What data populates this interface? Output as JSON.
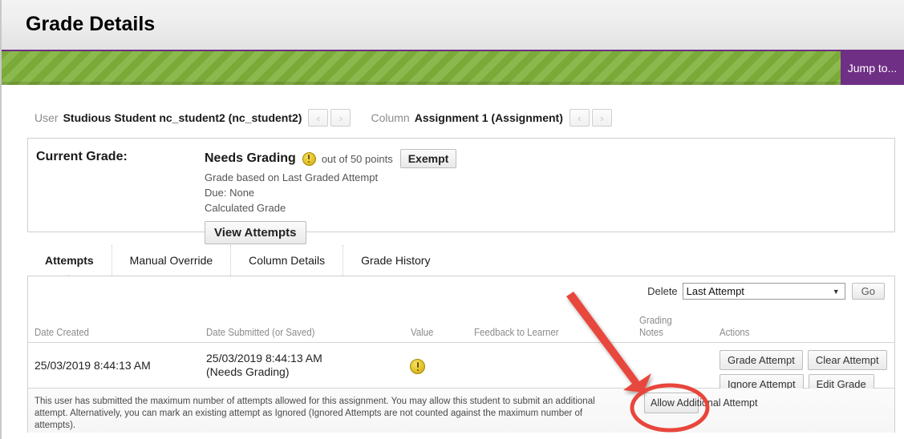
{
  "header": {
    "title": "Grade Details"
  },
  "banner": {
    "jump_to_label": "Jump to...",
    "accent_purple": "#6f2f84",
    "band_green": "#7fb13a"
  },
  "navigation": {
    "user_label": "User",
    "user_value": "Studious Student nc_student2 (nc_student2)",
    "user_prev": "‹",
    "user_next": "›",
    "column_label": "Column",
    "column_value": "Assignment 1 (Assignment)",
    "column_prev": "‹",
    "column_next": "›"
  },
  "current_grade": {
    "label": "Current Grade:",
    "grade_status": "Needs Grading",
    "status_icon": "warning-exclamation-icon",
    "out_of": "out of 50 points",
    "exempt_label": "Exempt",
    "based_on": "Grade based on Last Graded Attempt",
    "due": "Due: None",
    "calculated": "Calculated Grade",
    "view_attempts_label": "View Attempts"
  },
  "tabs": [
    {
      "label": "Attempts",
      "active": true
    },
    {
      "label": "Manual Override",
      "active": false
    },
    {
      "label": "Column Details",
      "active": false
    },
    {
      "label": "Grade History",
      "active": false
    }
  ],
  "delete_bar": {
    "label": "Delete",
    "selected_option": "Last Attempt",
    "caret_icon": "chevron-down-icon",
    "go_label": "Go"
  },
  "attempts_table": {
    "columns": [
      "Date Created",
      "Date Submitted (or Saved)",
      "Value",
      "Feedback to Learner",
      "Grading Notes",
      "Actions"
    ],
    "rows": [
      {
        "date_created": "25/03/2019 8:44:13 AM",
        "date_submitted": "25/03/2019 8:44:13 AM",
        "date_submitted_sub": "(Needs Grading)",
        "value_icon": "warning-exclamation-icon",
        "feedback": "",
        "grading_notes": "",
        "actions": [
          "Grade Attempt",
          "Clear Attempt",
          "Ignore Attempt",
          "Edit Grade"
        ]
      }
    ]
  },
  "footer_note": {
    "text": "This user has submitted the maximum number of attempts allowed for this assignment. You may allow this student to submit an additional attempt. Alternatively, you can mark an existing attempt as Ignored (Ignored Attempts are not counted against the maximum number of attempts).",
    "allow_button_label": "Allow Additional Attempt"
  },
  "annotations": {
    "arrow_color": "#e8463c",
    "highlight_color": "#e8463c",
    "arrow_name": "red-pointer-arrow",
    "highlight_name": "red-highlight-ellipse"
  }
}
